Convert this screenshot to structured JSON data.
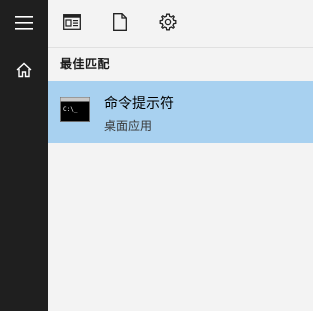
{
  "rail": {
    "menu_icon": "hamburger-menu-icon",
    "home_icon": "home-icon"
  },
  "toolbar": {
    "icons": [
      "document-list-icon",
      "document-icon",
      "gear-icon"
    ]
  },
  "results": {
    "section_title": "最佳匹配",
    "best_match": {
      "title": "命令提示符",
      "subtitle": "桌面应用",
      "icon": "command-prompt-icon",
      "icon_text": "C:\\_"
    }
  },
  "colors": {
    "rail_bg": "#1f1f1f",
    "panel_bg": "#f3f3f3",
    "selected_bg": "#a8d1f0"
  }
}
